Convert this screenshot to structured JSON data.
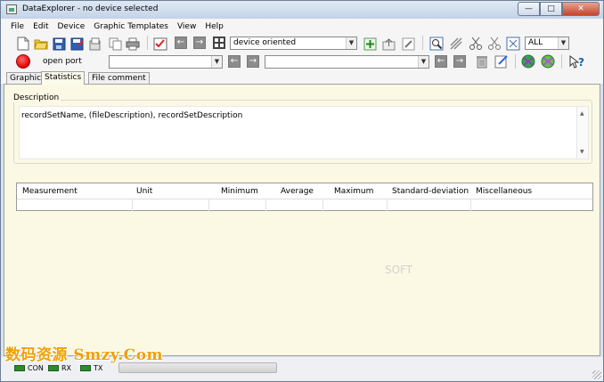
{
  "window": {
    "title": "DataExplorer  -  no device selected",
    "controls": {
      "minimize": "—",
      "maximize": "□",
      "close": "✕"
    }
  },
  "menu": [
    "File",
    "Edit",
    "Device",
    "Graphic Templates",
    "View",
    "Help"
  ],
  "toolbar": {
    "device_combo": "device oriented",
    "all_combo": "ALL",
    "open_port_label": "open port",
    "channel_combo": "",
    "record_combo": "",
    "icons": [
      "new-file-icon",
      "open-folder-icon",
      "save-icon",
      "save-as-icon",
      "print-preview-icon",
      "copy-icon",
      "print-icon",
      "device-select-icon",
      "arrow-left-icon",
      "arrow-right-icon",
      "device-grid-icon",
      "add-icon",
      "upload-icon",
      "edit-icon",
      "zoom-icon",
      "pan-icon",
      "cut-icon",
      "cut-alt-icon",
      "fit-icon",
      "record-icon",
      "trash-icon",
      "edit-sheet-icon",
      "globe-icon",
      "globe-off-icon",
      "help-pointer-icon"
    ]
  },
  "tabs": [
    "Graphic",
    "Statistics",
    "File comment"
  ],
  "active_tab": "Statistics",
  "description": {
    "legend": "Description",
    "text": "recordSetName, (fileDescription), recordSetDescription"
  },
  "stats_table": {
    "columns": [
      "Measurement",
      "Unit",
      "Minimum",
      "Average",
      "Maximum",
      "Standard-deviation",
      "Miscellaneous"
    ],
    "rows": []
  },
  "status": {
    "indicators": [
      "CON",
      "RX",
      "TX"
    ],
    "progress": 0
  },
  "watermark": {
    "cn_text": "数码资源 Smzy.Com",
    "gray_text": "SOFT"
  },
  "colors": {
    "content_bg": "#fbf8e4",
    "led_green": "#2e8b2e",
    "record_red": "#e00000",
    "watermark_orange": "#f0a000"
  }
}
